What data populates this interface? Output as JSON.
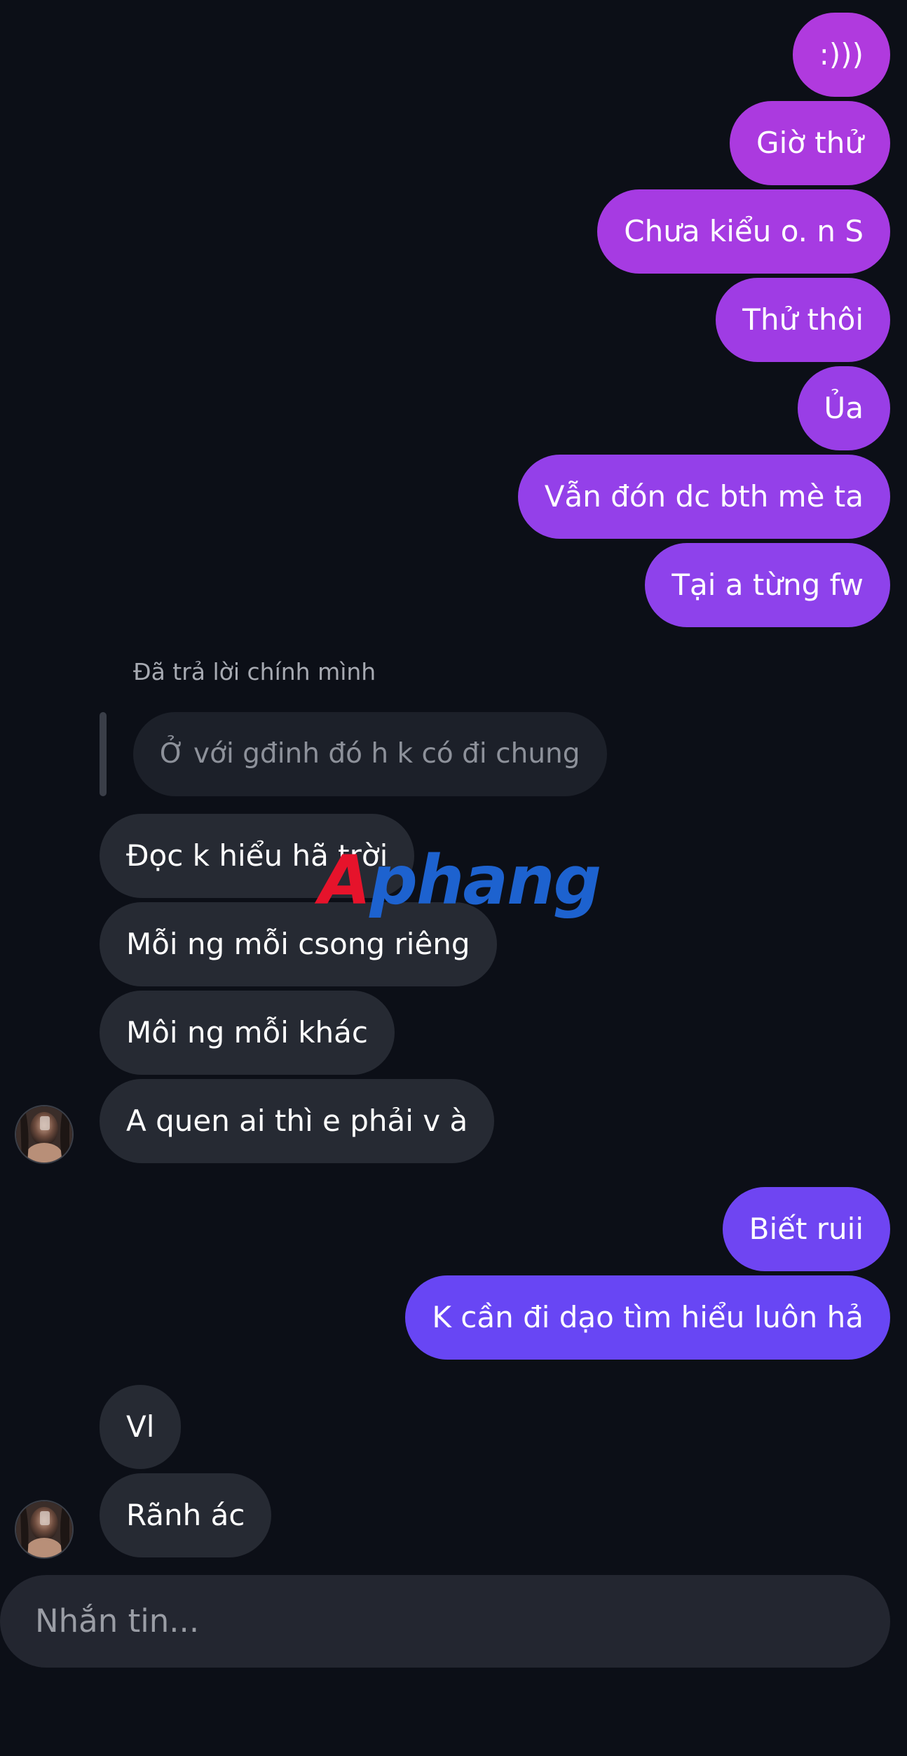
{
  "messages_sent_top": [
    {
      "text": ":)))",
      "color": "#b03ade"
    },
    {
      "text": "Giờ thử",
      "color": "#ab3adf"
    },
    {
      "text": "Chưa kiểu o. n S",
      "color": "#a63be2"
    },
    {
      "text": "Thử thôi",
      "color": "#9f3ce4"
    },
    {
      "text": "Ủa",
      "color": "#993ee6"
    },
    {
      "text": "Vẫn đón dc bth mè ta",
      "color": "#9440e9"
    },
    {
      "text": "Tại a từng fw",
      "color": "#8e42eb"
    }
  ],
  "reply": {
    "label": "Đã trả lời chính mình",
    "quoted_text": "Ở với gđinh đó h k có đi chung"
  },
  "messages_received_1": [
    {
      "text": "Đọc k hiểu hã trời"
    },
    {
      "text": "Mỗi ng mỗi csong riêng"
    },
    {
      "text": "Môi ng mỗi khác"
    },
    {
      "text": "A quen ai thì e phải v à"
    }
  ],
  "messages_sent_bottom": [
    {
      "text": "Biết ruii",
      "color": "#6f45f2"
    },
    {
      "text": "K cần đi dạo tìm hiểu luôn hả",
      "color": "#6846f4"
    }
  ],
  "messages_received_2": [
    {
      "text": "Vl"
    },
    {
      "text": "Rãnh ác"
    }
  ],
  "watermark": {
    "part_a": "A",
    "part_rest": "phang"
  },
  "composer": {
    "placeholder": "Nhắn tin..."
  }
}
